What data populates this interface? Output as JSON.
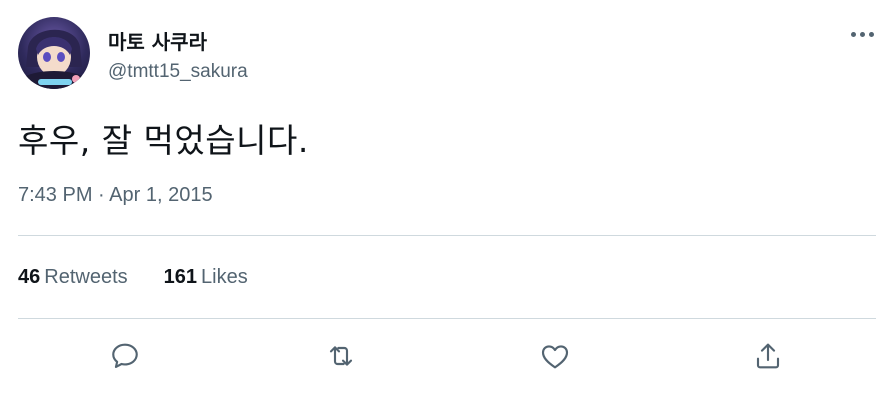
{
  "user": {
    "display_name": "마토 사쿠라",
    "handle": "@tmtt15_sakura"
  },
  "tweet": {
    "text": "후우, 잘 먹었습니다.",
    "timestamp": "7:43 PM · Apr 1, 2015"
  },
  "stats": {
    "retweets_count": "46",
    "retweets_label": "Retweets",
    "likes_count": "161",
    "likes_label": "Likes"
  },
  "actions": [
    "reply-icon",
    "retweet-icon",
    "like-icon",
    "share-icon"
  ],
  "colors": {
    "text_primary": "#0f1419",
    "text_secondary": "#536471",
    "divider": "#cfd9de",
    "icon": "#536471"
  }
}
